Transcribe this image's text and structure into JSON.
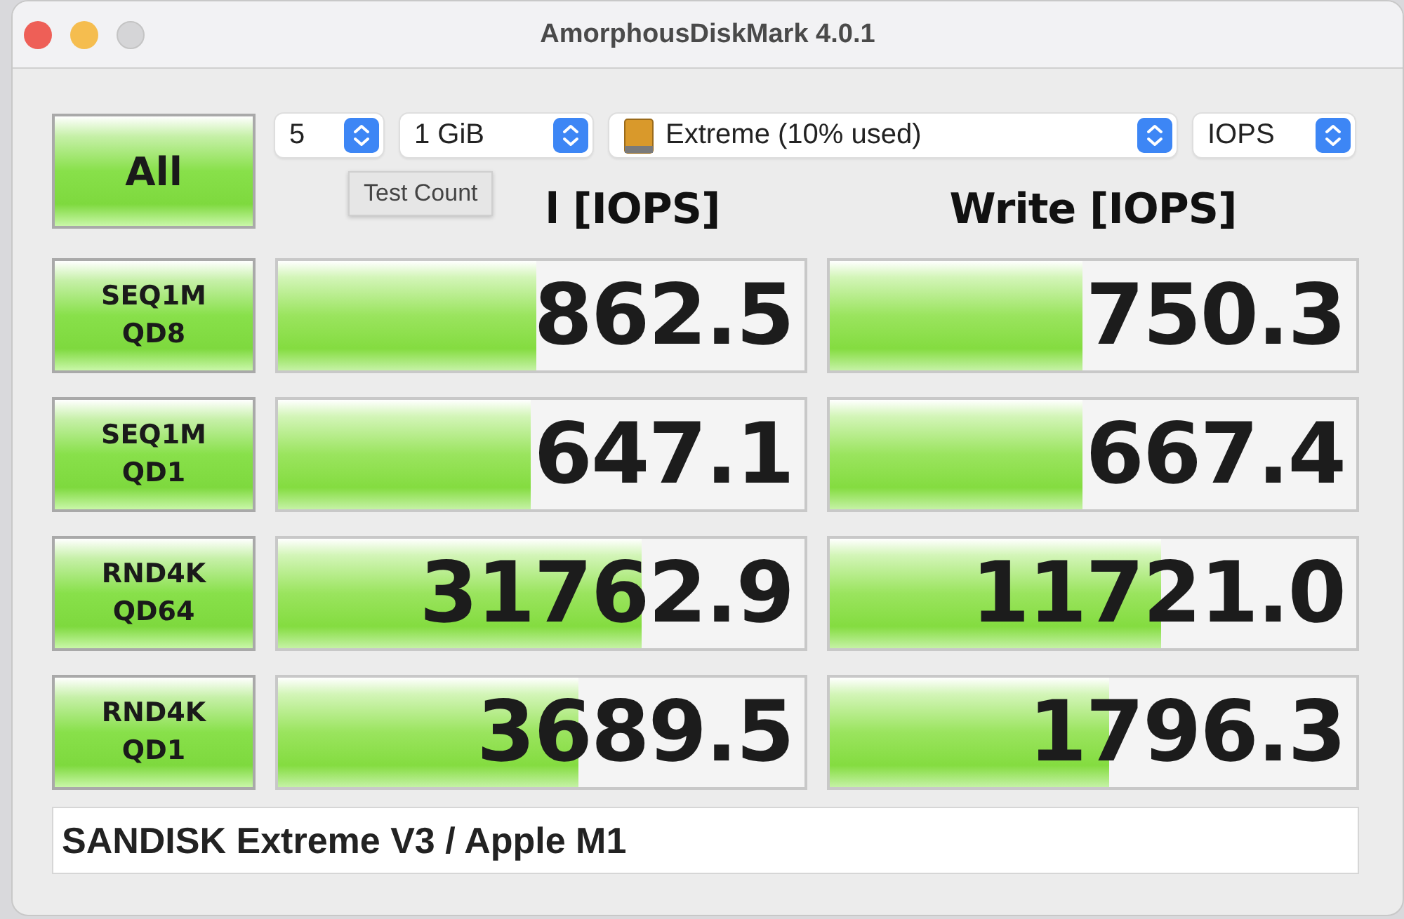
{
  "window": {
    "title": "AmorphousDiskMark 4.0.1"
  },
  "all_button": {
    "label": "All"
  },
  "selectors": [
    {
      "kind": "count",
      "value": "5"
    },
    {
      "kind": "size",
      "value": "1 GiB"
    },
    {
      "kind": "drive",
      "value": "Extreme (10% used)"
    },
    {
      "kind": "unit",
      "value": "IOPS"
    }
  ],
  "tooltip": {
    "text": "Test Count"
  },
  "columns": [
    {
      "heading": "l [IOPS]"
    },
    {
      "heading": "Write [IOPS]"
    }
  ],
  "rows": [
    {
      "test": "SEQ1M",
      "queue": "QD8",
      "read": {
        "value": "862.5",
        "level": 0.49
      },
      "write": {
        "value": "750.3",
        "level": 0.48
      }
    },
    {
      "test": "SEQ1M",
      "queue": "QD1",
      "read": {
        "value": "647.1",
        "level": 0.48
      },
      "write": {
        "value": "667.4",
        "level": 0.48
      }
    },
    {
      "test": "RND4K",
      "queue": "QD64",
      "read": {
        "value": "31762.9",
        "level": 0.69
      },
      "write": {
        "value": "11721.0",
        "level": 0.63
      }
    },
    {
      "test": "RND4K",
      "queue": "QD1",
      "read": {
        "value": "3689.5",
        "level": 0.57
      },
      "write": {
        "value": "1796.3",
        "level": 0.53
      }
    }
  ],
  "comment": {
    "value": "SANDISK Extreme V3 / Apple M1"
  }
}
